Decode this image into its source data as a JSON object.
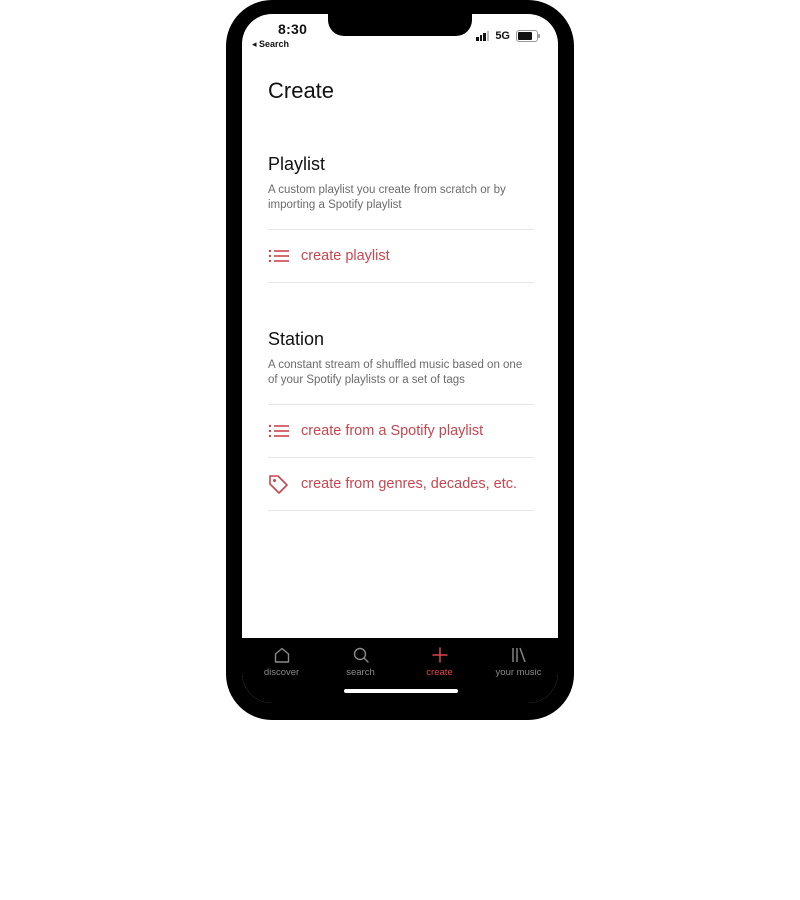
{
  "status_bar": {
    "time": "8:30",
    "back_label": "◂ Search",
    "network": "5G"
  },
  "page": {
    "title": "Create"
  },
  "playlist_section": {
    "title": "Playlist",
    "description": "A custom playlist you create from scratch or by importing a Spotify playlist",
    "actions": [
      {
        "label": "create playlist",
        "icon": "list-icon"
      }
    ]
  },
  "station_section": {
    "title": "Station",
    "description": "A constant stream of shuffled music based on one of your Spotify playlists or a set of tags",
    "actions": [
      {
        "label": "create from a Spotify playlist",
        "icon": "list-icon"
      },
      {
        "label": "create from genres, decades, etc.",
        "icon": "tag-icon"
      }
    ]
  },
  "tab_bar": {
    "tabs": [
      {
        "label": "discover",
        "icon": "home-icon"
      },
      {
        "label": "search",
        "icon": "search-icon"
      },
      {
        "label": "create",
        "icon": "plus-icon",
        "active": true
      },
      {
        "label": "your music",
        "icon": "library-icon"
      }
    ]
  },
  "colors": {
    "accent": "#c9464f",
    "tab_active": "#e0444f",
    "tab_inactive": "#8a8a8a",
    "tab_bar_bg": "#000000"
  }
}
